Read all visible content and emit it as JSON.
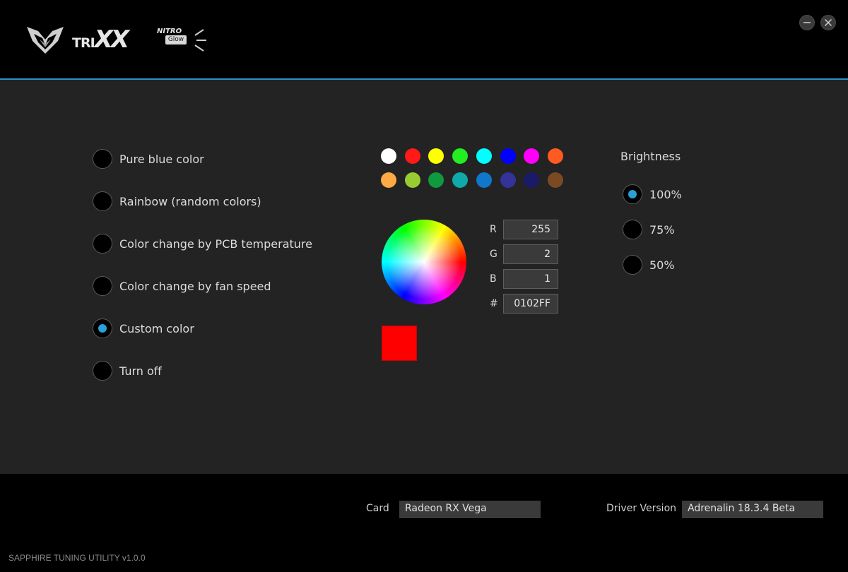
{
  "header": {
    "brand": {
      "part1": "TRI",
      "part2": "XX",
      "badge_top": "NITRO",
      "badge_bottom": "Glow"
    },
    "accent_color": "#2f8fc6"
  },
  "window_controls": {
    "minimize_icon": "minimize-icon",
    "close_icon": "close-icon"
  },
  "modes": [
    {
      "label": "Pure blue color",
      "checked": false
    },
    {
      "label": "Rainbow (random colors)",
      "checked": false
    },
    {
      "label": "Color change by PCB temperature",
      "checked": false
    },
    {
      "label": "Color change by fan speed",
      "checked": false
    },
    {
      "label": "Custom color",
      "checked": true
    },
    {
      "label": "Turn off",
      "checked": false
    }
  ],
  "palette": {
    "row1": [
      "#ffffff",
      "#ff1a1a",
      "#ffff00",
      "#22ee22",
      "#00ffff",
      "#0000ff",
      "#ff00ff",
      "#ff5a22"
    ],
    "row2": [
      "#ffaa44",
      "#99cc33",
      "#11993f",
      "#11aaaa",
      "#1177cc",
      "#333399",
      "#1a1a66",
      "#7a4a22"
    ]
  },
  "color_picker": {
    "r_label": "R",
    "r_value": "255",
    "g_label": "G",
    "g_value": "2",
    "b_label": "B",
    "b_value": "1",
    "hex_label": "#",
    "hex_value": "0102FF",
    "preview_color": "#ff0000"
  },
  "brightness": {
    "title": "Brightness",
    "options": [
      {
        "label": "100%",
        "checked": true
      },
      {
        "label": "75%",
        "checked": false
      },
      {
        "label": "50%",
        "checked": false
      }
    ]
  },
  "footer": {
    "card_label": "Card",
    "card_value": "Radeon RX Vega",
    "driver_label": "Driver Version",
    "driver_value": "Adrenalin 18.3.4 Beta",
    "version": "SAPPHIRE TUNING UTILITY v1.0.0"
  }
}
